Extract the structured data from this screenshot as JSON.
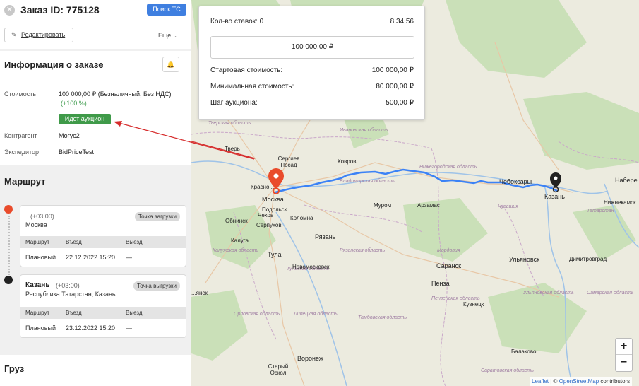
{
  "header": {
    "close_icon": "close-icon",
    "title": "Заказ ID: 775128",
    "search_button": "Поиск ТС",
    "edit_button": "Редактировать",
    "more_label": "Еще"
  },
  "info": {
    "title": "Информация о заказе",
    "bell_icon": "bell-icon",
    "cost_label": "Стоимость",
    "cost_value": "100 000,00 ₽ (Безналичный, Без НДС)",
    "cost_percent": "(+100 %)",
    "auction_badge": "Идет аукцион",
    "counterparty_label": "Контрагент",
    "counterparty_value": "Могус2",
    "forwarder_label": "Экспедитор",
    "forwarder_value": "BidPriceTest"
  },
  "route": {
    "title": "Маршрут",
    "stops": [
      {
        "city": "",
        "tz": "(+03:00)",
        "region": "Москва",
        "badge": "Точка загрузки",
        "col1": "Маршрут",
        "col2": "Въезд",
        "col3": "Выезд",
        "row_label": "Плановый",
        "row_in": "22.12.2022 15:20",
        "row_out": "—"
      },
      {
        "city": "Казань",
        "tz": "(+03:00)",
        "region": "Республика Татарстан, Казань",
        "badge": "Точка выгрузки",
        "col1": "Маршрут",
        "col2": "Въезд",
        "col3": "Выезд",
        "row_label": "Плановый",
        "row_in": "23.12.2022 15:20",
        "row_out": "—"
      }
    ]
  },
  "cargo": {
    "title": "Груз"
  },
  "auction": {
    "bids_count": "Кол-во ставок: 0",
    "timer": "8:34:56",
    "current_bid": "100 000,00 ₽",
    "start_label": "Стартовая стоимость:",
    "start_value": "100 000,00 ₽",
    "min_label": "Минимальная стоимость:",
    "min_value": "80 000,00 ₽",
    "step_label": "Шаг аукциона:",
    "step_value": "500,00 ₽"
  },
  "map": {
    "labels": {
      "moscow": "Москва",
      "kazan": "Казань",
      "tver": "Тверь",
      "sergiev": "Сергиев Посад",
      "kovrov": "Ковров",
      "murom": "Муром",
      "arzamas": "Арзамас",
      "cheboksary": "Чебоксары",
      "kaluga": "Калуга",
      "tula": "Тула",
      "ryazan": "Рязань",
      "serpukhov": "Серпухов",
      "podolsk": "Подольск",
      "kolomna": "Коломна",
      "obninsk": "Обнинск",
      "novomoskovsk": "Новомосковск",
      "saransk": "Саранск",
      "ulyanovsk": "Ульяновск",
      "dimitrovgrad": "Димитровград",
      "penza": "Пенза",
      "voronezh": "Воронеж",
      "stary_oskol": "Старый Оскол",
      "balakovo": "Балаково",
      "kuznetsk": "Кузнецк",
      "nizhnekamsk": "Нижнекамск",
      "nabereznye": "Набере...",
      "krasno": "Красно...",
      "lipetsk_obl": "Липецкая область",
      "tambov_obl": "Тамбовская область",
      "penza_obl": "Пензенская область",
      "mordovia": "Мордовия",
      "samara_obl": "Самарская область",
      "ulyanovsk_obl": "Ульяновская область",
      "tatarstan": "Татарстан",
      "vladimir_obl": "Владимирская область",
      "ivanovo_obl": "Ивановская область",
      "nizhny_obl": "Нижегородская область",
      "ryazan_obl": "Рязанская область",
      "tula_obl": "Тульская область",
      "orel_obl": "Орловская область",
      "kaluga_obl": "Калужская область",
      "chuvashia": "Чувашия",
      "tver_obl": "Тверская область",
      "yaroslavl_obl": "Ярославская область",
      "saratov_obl": "Саратовская область",
      "chekhov": "Чехов",
      "kaluga_short": "Ка...",
      "ansk": "...янск"
    },
    "zoom_in": "+",
    "zoom_out": "−",
    "attribution_leaflet": "Leaflet",
    "attribution_sep": " | © ",
    "attribution_osm": "OpenStreetMap",
    "attribution_rest": " contributors"
  },
  "colors": {
    "primary": "#3f7fe0",
    "success": "#3f9a49",
    "route_line": "#3b82f6",
    "pin_start": "#e94b2b",
    "pin_end": "#222222",
    "arrow": "#d62b2b"
  }
}
